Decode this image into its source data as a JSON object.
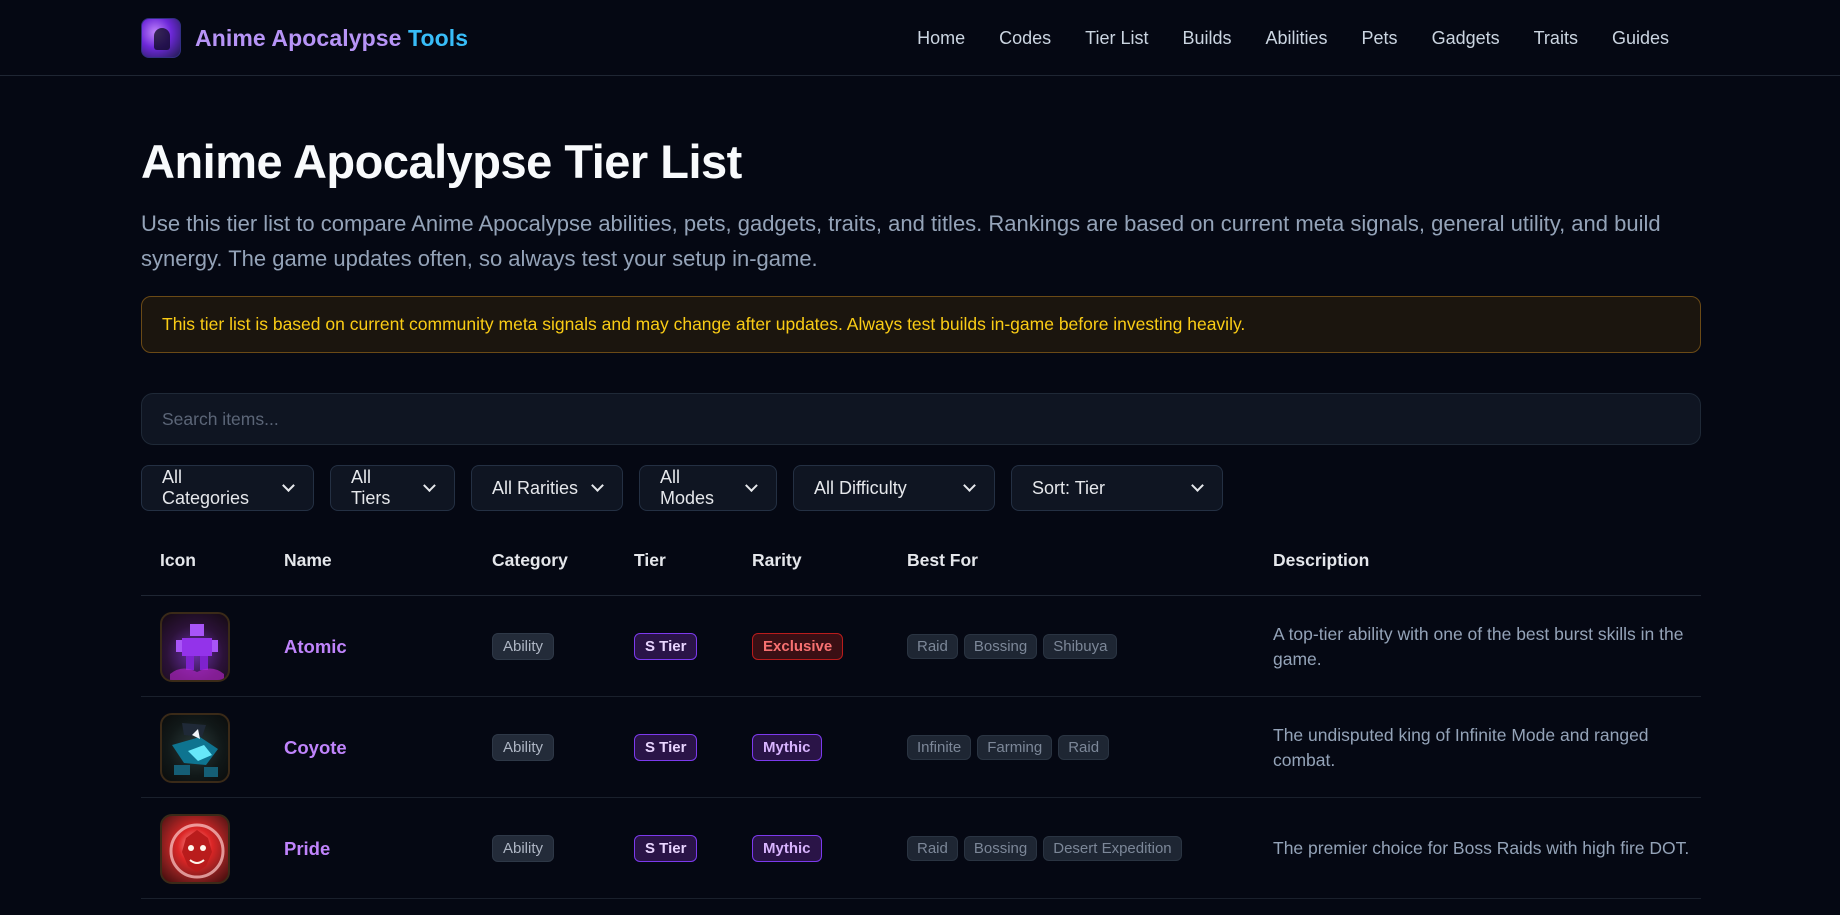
{
  "header": {
    "brand_part1": "Anime Apocalypse",
    "brand_part2": "Tools",
    "nav": [
      "Home",
      "Codes",
      "Tier List",
      "Builds",
      "Abilities",
      "Pets",
      "Gadgets",
      "Traits",
      "Guides"
    ]
  },
  "page": {
    "title": "Anime Apocalypse Tier List",
    "intro": "Use this tier list to compare Anime Apocalypse abilities, pets, gadgets, traits, and titles. Rankings are based on current meta signals, general utility, and build synergy. The game updates often, so always test your setup in-game.",
    "notice": "This tier list is based on current community meta signals and may change after updates. Always test builds in-game before investing heavily.",
    "search_placeholder": "Search items..."
  },
  "filters": [
    "All Categories",
    "All Tiers",
    "All Rarities",
    "All Modes",
    "All Difficulty",
    "Sort: Tier"
  ],
  "table": {
    "headers": [
      "Icon",
      "Name",
      "Category",
      "Tier",
      "Rarity",
      "Best For",
      "Description"
    ],
    "rows": [
      {
        "icon": "atomic-icon",
        "name": "Atomic",
        "category": "Ability",
        "tier": "S Tier",
        "rarity": "Exclusive",
        "best_for": [
          "Raid",
          "Bossing",
          "Shibuya"
        ],
        "description": "A top-tier ability with one of the best burst skills in the game."
      },
      {
        "icon": "coyote-icon",
        "name": "Coyote",
        "category": "Ability",
        "tier": "S Tier",
        "rarity": "Mythic",
        "best_for": [
          "Infinite",
          "Farming",
          "Raid"
        ],
        "description": "The undisputed king of Infinite Mode and ranged combat."
      },
      {
        "icon": "pride-icon",
        "name": "Pride",
        "category": "Ability",
        "tier": "S Tier",
        "rarity": "Mythic",
        "best_for": [
          "Raid",
          "Bossing",
          "Desert Expedition"
        ],
        "description": "The premier choice for Boss Raids with high fire DOT."
      }
    ]
  }
}
